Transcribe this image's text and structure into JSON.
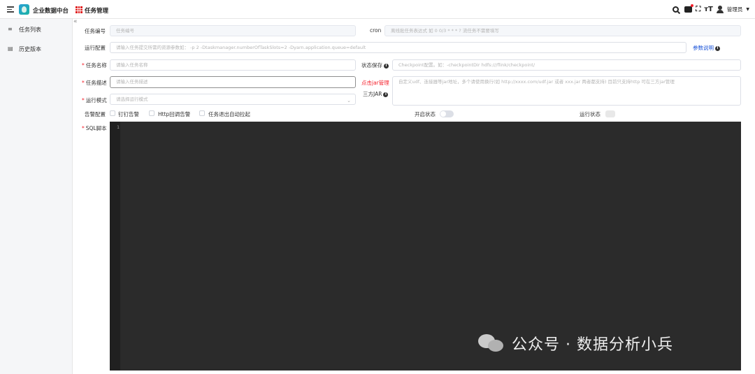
{
  "header": {
    "app_name": "企业数据中台",
    "page_title": "任务管理",
    "user_name": "管理员",
    "icons": [
      "menu-icon",
      "app-logo-icon",
      "apps-grid-icon",
      "search-icon",
      "message-icon",
      "fullscreen-icon",
      "font-size-icon",
      "user-icon"
    ],
    "font_size_glyph": "тТ",
    "fullscreen_glyph": "⛶"
  },
  "sidebar": {
    "collapse_glyph": "«",
    "items": [
      {
        "label": "任务列表",
        "icon": "list-icon"
      },
      {
        "label": "历史版本",
        "icon": "history-icon"
      }
    ]
  },
  "form": {
    "task_id": {
      "label": "任务编号",
      "placeholder": "任务编号"
    },
    "cron": {
      "label": "cron",
      "placeholder": "离线批任务表达式 如 0 0/3 * * * ?  流任务不需要填写"
    },
    "run_config": {
      "label": "运行配置",
      "placeholder": "请输入任务提交所需的资源参数如：  -p 2  -Dtaskmanager.numberOfTaskSlots=2 -Dyarn.application.queue=default"
    },
    "param_help": "参数说明",
    "task_name": {
      "label": "任务名称",
      "placeholder": "请输入任务名称"
    },
    "state_save": {
      "label": "状态保存",
      "placeholder": "Checkpoint配置。如：-checkpointDir hdfs:///flink/checkpoint/"
    },
    "task_desc": {
      "label": "任务描述",
      "placeholder": "请输入任务描述"
    },
    "jar_manage": "点击jar管理",
    "third_jar": {
      "label": "三方JAR",
      "placeholder": "自定义udf、连接器等jar地址，多个请使用换行(如 http://xxxx.com/udf.jar 或者 xxx.jar 两者都支持) 目前只支持http 可在三方jar管理"
    },
    "run_mode": {
      "label": "运行模式",
      "placeholder": "请选择运行模式"
    },
    "alert_config": {
      "label": "告警配置",
      "options": [
        "钉钉告警",
        "Http回调告警",
        "任务退出自动拉起"
      ]
    },
    "enable_state": {
      "label": "开启状态"
    },
    "run_state": {
      "label": "运行状态"
    },
    "sql_script": {
      "label": "SQL脚本",
      "first_line_number": "1"
    }
  },
  "watermark": {
    "text": "公众号 · 数据分析小兵",
    "icon": "wechat-icon"
  },
  "colors": {
    "required": "#f5222d",
    "link_blue": "#1a53d8",
    "link_red": "#f5222d",
    "editor_bg": "#2b2b2b",
    "sidebar_bg": "#f5f6f8"
  }
}
